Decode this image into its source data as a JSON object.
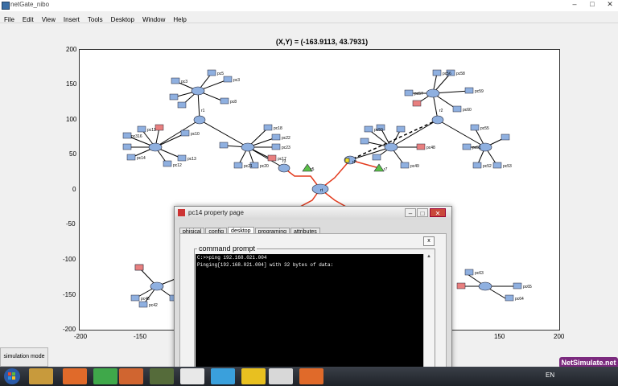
{
  "window": {
    "title": "netGate_nibo",
    "controls": [
      "–",
      "□",
      "✕"
    ]
  },
  "menu": [
    "File",
    "Edit",
    "View",
    "Insert",
    "Tools",
    "Desktop",
    "Window",
    "Help"
  ],
  "plot": {
    "title": "(X,Y) = (-163.9113, 43.7931)",
    "x_ticks": [
      "-200",
      "-150",
      "-100",
      "-50",
      "0",
      "50",
      "100",
      "150",
      "200"
    ],
    "y_ticks": [
      "200",
      "150",
      "100",
      "50",
      "0",
      "-50",
      "-100",
      "-150",
      "-200"
    ],
    "colors": {
      "router": "#8fb0e0",
      "pc": "#8fb0e0",
      "pc_down": "#e87f7f",
      "link_active": "#e33b1e",
      "switch_green": "#5bbf48"
    },
    "node_labels": {
      "top_left_switch": [
        "pc3",
        "pc5",
        "pc3",
        "pc8"
      ],
      "left_cluster": [
        "pc316",
        "pc13",
        "pc11",
        "pc9",
        "pc10",
        "pc13",
        "pc14",
        "pc12"
      ],
      "center_left": [
        "pc18",
        "pc22",
        "pc23",
        "pc17",
        "pc20",
        "pc21"
      ],
      "routers": [
        "r1",
        "r2",
        "r3",
        "r4",
        "r5",
        "r7",
        "rt",
        "rP"
      ],
      "top_right": [
        "pc56",
        "pc58",
        "pc59",
        "pc57",
        "pc60"
      ],
      "right_cluster": [
        "pc55",
        "pc50",
        "pc48",
        "pc49",
        "pc51",
        "pc52",
        "pc53",
        "pc46",
        "pc47"
      ],
      "bottom": [
        "pc45",
        "pc42",
        "pc65",
        "pc64",
        "pc63",
        "pc62"
      ]
    }
  },
  "property_window": {
    "title": "pc14  property page",
    "controls": [
      "–",
      "□",
      "✕"
    ],
    "tabs": [
      "phisical",
      "config",
      "desktop",
      "programing",
      "attributes"
    ],
    "active_tab": "desktop",
    "close_label": "x",
    "group_label": "command prompt",
    "console_lines": [
      "C:>>ping 192.168.021.004",
      "Pinging[192.168.021.004] with 32 bytes of data:"
    ]
  },
  "simulation_button": "simulation mode",
  "taskbar": {
    "lang": "EN",
    "watermark": "NetSimulate.net"
  }
}
